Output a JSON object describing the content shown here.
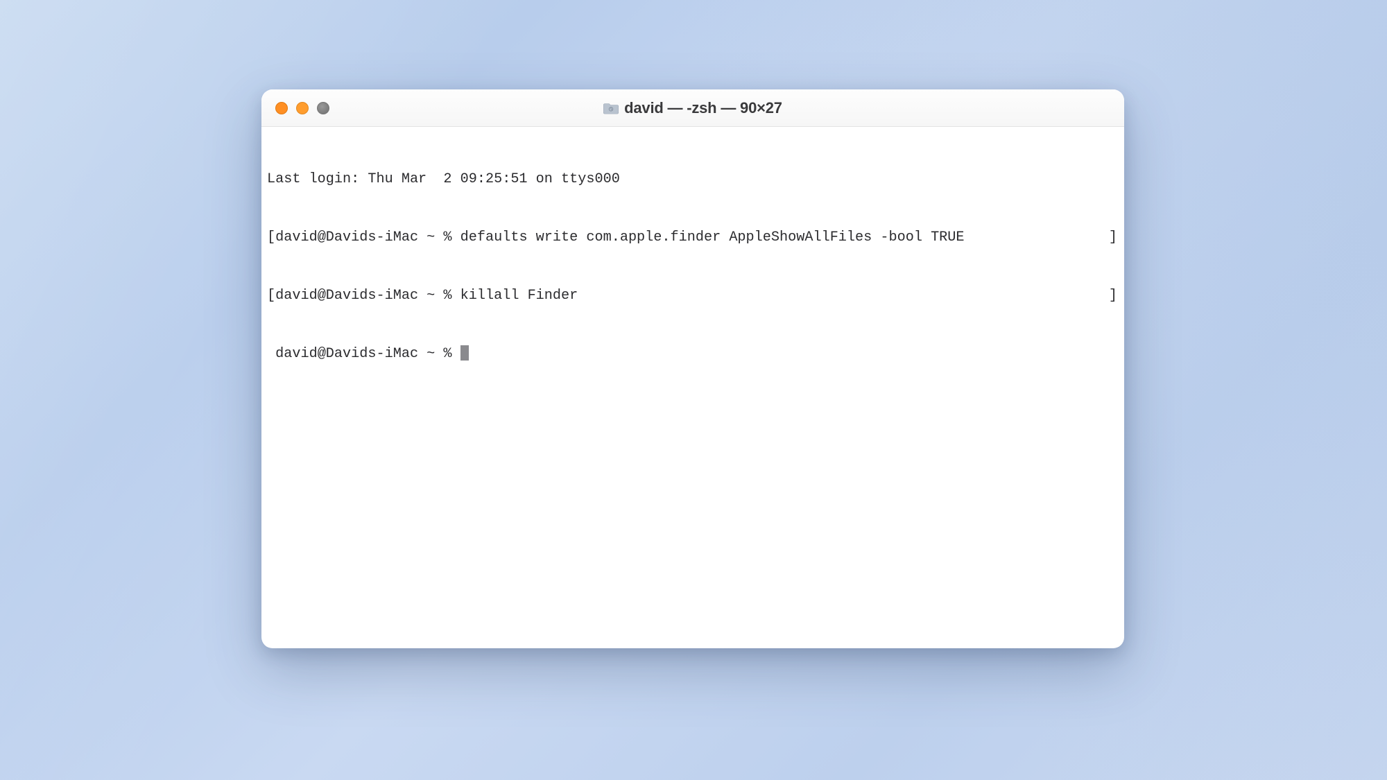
{
  "window": {
    "title": "david — -zsh — 90×27"
  },
  "terminal": {
    "login_line": "Last login: Thu Mar  2 09:25:51 on ttys000",
    "lines": [
      {
        "bracket_l": "[",
        "prompt": "david@Davids-iMac ~ % ",
        "command": "defaults write com.apple.finder AppleShowAllFiles -bool TRUE",
        "bracket_r": "]"
      },
      {
        "bracket_l": "[",
        "prompt": "david@Davids-iMac ~ % ",
        "command": "killall Finder",
        "bracket_r": "]"
      }
    ],
    "current_prompt": "david@Davids-iMac ~ % "
  }
}
